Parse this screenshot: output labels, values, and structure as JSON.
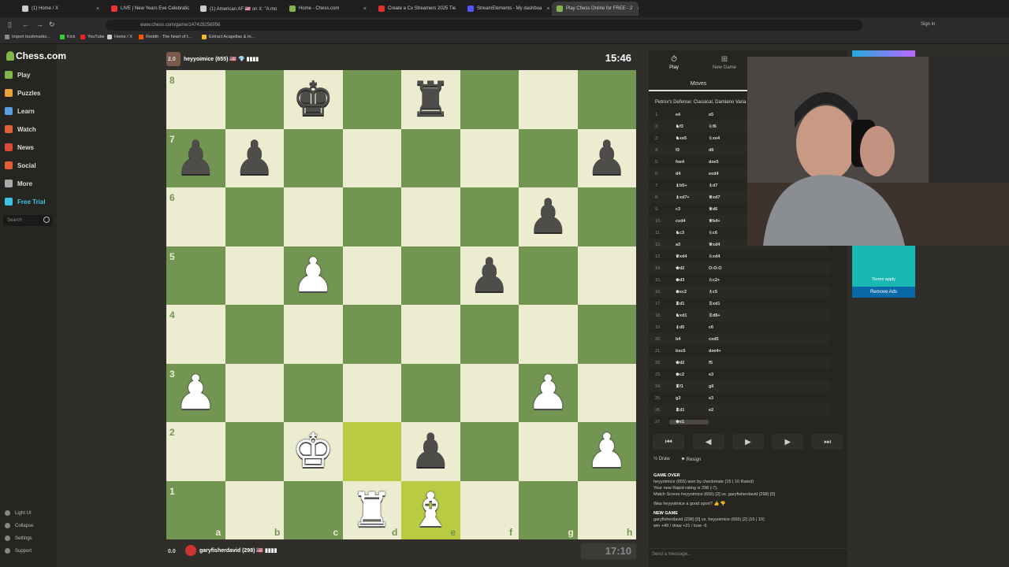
{
  "browser": {
    "tabs": [
      {
        "label": "(1) Home / X",
        "color": "#ccc"
      },
      {
        "label": "LIVE | New Years Eve Celebratic",
        "color": "#e33"
      },
      {
        "label": "(1) American AF 🇺🇸 on X: \"A mo",
        "color": "#ccc"
      },
      {
        "label": "Home - Chess.com",
        "color": "#81b64c"
      },
      {
        "label": "Create a Cx Streamers 2025 Tie",
        "color": "#d33"
      },
      {
        "label": "StreamElements - My dashboa",
        "color": "#55f"
      },
      {
        "label": "Play Chess Online for FREE - 2",
        "color": "#81b64c"
      }
    ],
    "url": "www.chess.com/game/147429256956",
    "signin": "Sign in",
    "bookmarks": [
      "Import bookmarks...",
      "Kick",
      "YouTube",
      "Home / X",
      "Reddit - The heart of t...",
      "Extract Acapellas & In..."
    ]
  },
  "sidebar": {
    "logo": "Chess.com",
    "items": [
      {
        "label": "Play",
        "color": "#81b64c"
      },
      {
        "label": "Puzzles",
        "color": "#e8a33d"
      },
      {
        "label": "Learn",
        "color": "#5aa0e0"
      },
      {
        "label": "Watch",
        "color": "#e0603a"
      },
      {
        "label": "News",
        "color": "#d94a3a"
      },
      {
        "label": "Social",
        "color": "#e0603a"
      },
      {
        "label": "More",
        "color": "#aaa"
      },
      {
        "label": "Free Trial",
        "color": "#3ec0e0"
      }
    ],
    "search_placeholder": "Search",
    "footer": [
      "Light UI",
      "Collapse",
      "Settings",
      "Support"
    ]
  },
  "top_player": {
    "name": "heyyoimice (655) 🇺🇸 💎 ▮▮▮▮",
    "eval": "2.0",
    "clock": "15:46"
  },
  "bottom_player": {
    "name": "garyfisherdavid (298) 🇺🇸 ▮▮▮▮",
    "eval": "0.0",
    "clock": "17:10"
  },
  "board": {
    "ranks": [
      "8",
      "7",
      "6",
      "5",
      "4",
      "3",
      "2",
      "1"
    ],
    "files": [
      "a",
      "b",
      "c",
      "d",
      "e",
      "f",
      "g",
      "h"
    ],
    "highlights": [
      "d2",
      "e1"
    ],
    "pieces": [
      {
        "sq": "c8",
        "p": "♚",
        "side": "b"
      },
      {
        "sq": "e8",
        "p": "♜",
        "side": "b"
      },
      {
        "sq": "a7",
        "p": "♟",
        "side": "b"
      },
      {
        "sq": "b7",
        "p": "♟",
        "side": "b"
      },
      {
        "sq": "h7",
        "p": "♟",
        "side": "b"
      },
      {
        "sq": "g6",
        "p": "♟",
        "side": "b"
      },
      {
        "sq": "c5",
        "p": "♟",
        "side": "w"
      },
      {
        "sq": "f5",
        "p": "♟",
        "side": "b"
      },
      {
        "sq": "a3",
        "p": "♟",
        "side": "w"
      },
      {
        "sq": "g3",
        "p": "♟",
        "side": "w"
      },
      {
        "sq": "c2",
        "p": "♚",
        "side": "w"
      },
      {
        "sq": "e2",
        "p": "♟",
        "side": "b"
      },
      {
        "sq": "h2",
        "p": "♟",
        "side": "w"
      },
      {
        "sq": "d1",
        "p": "♜",
        "side": "w"
      },
      {
        "sq": "e1",
        "p": "♝",
        "side": "w"
      }
    ]
  },
  "panel": {
    "tabs": [
      "Play",
      "New Game"
    ],
    "moves_header": "Moves",
    "opening": "Petrov's Defense: Classical, Damiano Varia",
    "moves": [
      [
        "1.",
        "e4",
        "e5"
      ],
      [
        "2.",
        "♞f3",
        "♘f6"
      ],
      [
        "3.",
        "♞xe5",
        "♘xe4"
      ],
      [
        "4.",
        "f3",
        "d6"
      ],
      [
        "5.",
        "fxe4",
        "dxe5"
      ],
      [
        "6.",
        "d4",
        "exd4"
      ],
      [
        "7.",
        "♝b5+",
        "♗d7"
      ],
      [
        "8.",
        "♝xd7+",
        "♕xd7"
      ],
      [
        "9.",
        "c3",
        "♕d6"
      ],
      [
        "10.",
        "cxd4",
        "♕b4+"
      ],
      [
        "11.",
        "♞c3",
        "♘c6"
      ],
      [
        "12.",
        "a3",
        "♕xd4"
      ],
      [
        "13.",
        "♛xd4",
        "♘xd4"
      ],
      [
        "14.",
        "♚d2",
        "O-O-O"
      ],
      [
        "15.",
        "♚d3",
        "♘c2+"
      ],
      [
        "16.",
        "♚xc2",
        "♗c5"
      ],
      [
        "17.",
        "♜d1",
        "♖xd1"
      ],
      [
        "18.",
        "♞xd1",
        "♖d8+"
      ],
      [
        "19.",
        "♝d5",
        "c6"
      ],
      [
        "20.",
        "b4",
        "cxd5"
      ],
      [
        "21.",
        "bxc5",
        "dxe4+"
      ],
      [
        "22.",
        "♚d2",
        "f5"
      ],
      [
        "23.",
        "♚c2",
        "e3"
      ],
      [
        "24.",
        "♜f1",
        "g6"
      ],
      [
        "25.",
        "g3",
        "e3"
      ],
      [
        "26.",
        "♜d1",
        "e2"
      ],
      [
        "27.",
        "♚e1",
        ""
      ]
    ],
    "controls": [
      "⏮",
      "◀",
      "▶",
      "▶",
      "⏭"
    ],
    "draw": "Draw",
    "resign": "Resign",
    "game_over_title": "GAME OVER",
    "result_line": "heyyoimice (655) won by checkmate (15 | 10 Rated)",
    "rating_line": "Your new Rapid rating is 298 (-7).",
    "match_line": "Match Scores heyyoimice (655) [2] vs. garyfisherdavid (298) [0]",
    "sport_question": "Was heyyoimice a good sport?",
    "new_game_title": "NEW GAME",
    "new_game_line": "garyfisherdavid (298) [0] vs. heyyoimice (655) [2] (15 | 10)",
    "record_line": "win +49 / draw +21 / lose -6",
    "message_placeholder": "Send a message..."
  },
  "ad": {
    "terms": "Terms apply",
    "remove": "Remove Ads"
  }
}
